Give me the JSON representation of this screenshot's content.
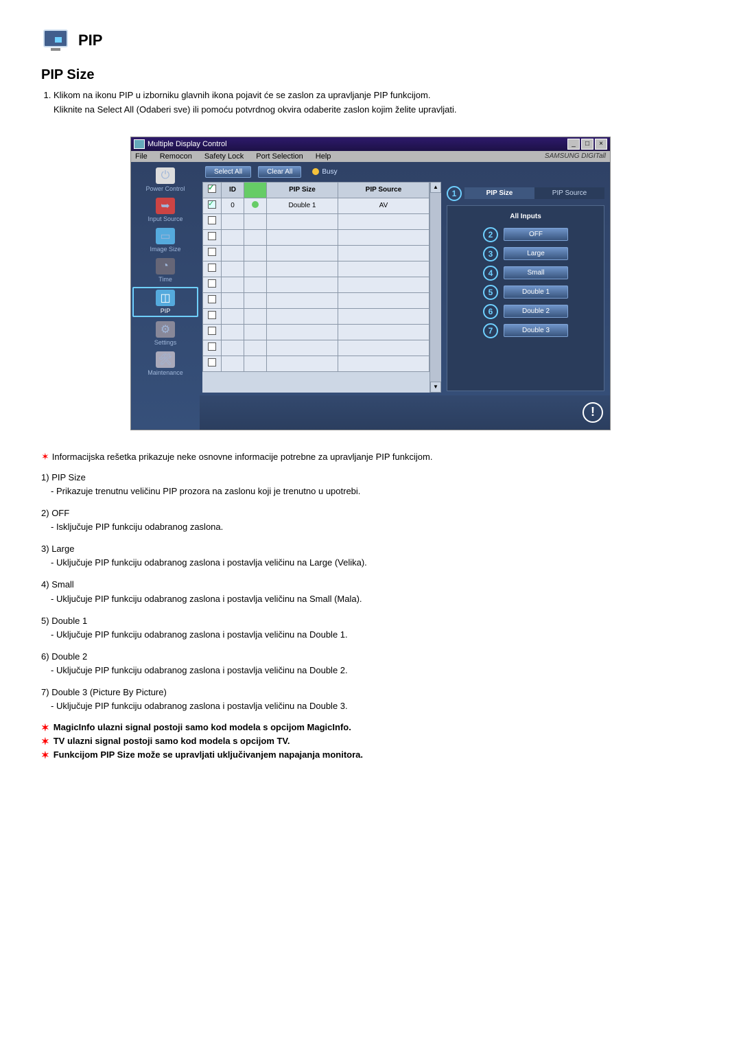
{
  "header": {
    "title": "PIP"
  },
  "section_title": "PIP Size",
  "intro": [
    "Klikom na ikonu PIP u izborniku glavnih ikona pojavit će se zaslon za upravljanje PIP funkcijom.",
    "Kliknite na Select All (Odaberi sve) ili pomoću potvrdnog okvira odaberite zaslon kojim želite upravljati."
  ],
  "app": {
    "title": "Multiple Display Control",
    "menu": [
      "File",
      "Remocon",
      "Safety Lock",
      "Port Selection",
      "Help"
    ],
    "brand": "SAMSUNG DIGITall",
    "sidebar": [
      {
        "label": "Power Control",
        "active": false
      },
      {
        "label": "Input Source",
        "active": false
      },
      {
        "label": "Image Size",
        "active": false
      },
      {
        "label": "Time",
        "active": false
      },
      {
        "label": "PIP",
        "active": true
      },
      {
        "label": "Settings",
        "active": false
      },
      {
        "label": "Maintenance",
        "active": false
      }
    ],
    "toolbar": {
      "select_all": "Select All",
      "clear_all": "Clear All",
      "busy": "Busy"
    },
    "grid": {
      "headers": {
        "check": "",
        "id": "ID",
        "status": "",
        "pip_size": "PIP Size",
        "pip_source": "PIP Source"
      },
      "row": {
        "id": "0",
        "pip_size": "Double 1",
        "pip_source": "AV"
      }
    },
    "panel": {
      "tabs": {
        "size": "PIP Size",
        "source": "PIP Source"
      },
      "all_inputs": "All Inputs",
      "options": [
        {
          "n": "2",
          "label": "OFF"
        },
        {
          "n": "3",
          "label": "Large"
        },
        {
          "n": "4",
          "label": "Small"
        },
        {
          "n": "5",
          "label": "Double 1"
        },
        {
          "n": "6",
          "label": "Double 2"
        },
        {
          "n": "7",
          "label": "Double 3"
        }
      ],
      "tab_num": "1"
    }
  },
  "info_line": "Informacijska rešetka prikazuje neke osnovne informacije potrebne za upravljanje PIP funkcijom.",
  "items": [
    {
      "n": "1",
      "title": "PIP Size",
      "desc": "- Prikazuje trenutnu veličinu PIP prozora na zaslonu koji je trenutno u upotrebi."
    },
    {
      "n": "2",
      "title": "OFF",
      "desc": "- Isključuje PIP funkciju odabranog zaslona."
    },
    {
      "n": "3",
      "title": "Large",
      "desc": "- Uključuje PIP funkciju odabranog zaslona i postavlja veličinu na Large (Velika)."
    },
    {
      "n": "4",
      "title": "Small",
      "desc": "- Uključuje PIP funkciju odabranog zaslona i postavlja veličinu na Small (Mala)."
    },
    {
      "n": "5",
      "title": "Double 1",
      "desc": "- Uključuje PIP funkciju odabranog zaslona i postavlja veličinu na Double 1."
    },
    {
      "n": "6",
      "title": "Double 2",
      "desc": "- Uključuje PIP funkciju odabranog zaslona i postavlja veličinu na Double 2."
    },
    {
      "n": "7",
      "title": "Double 3 (Picture By Picture)",
      "desc": "- Uključuje PIP funkciju odabranog zaslona i postavlja veličinu na Double 3."
    }
  ],
  "notes": [
    "MagicInfo ulazni signal postoji samo kod modela s opcijom MagicInfo.",
    "TV ulazni signal postoji samo kod modela s opcijom TV.",
    "Funkcijom PIP Size može se upravljati uključivanjem napajanja monitora."
  ]
}
